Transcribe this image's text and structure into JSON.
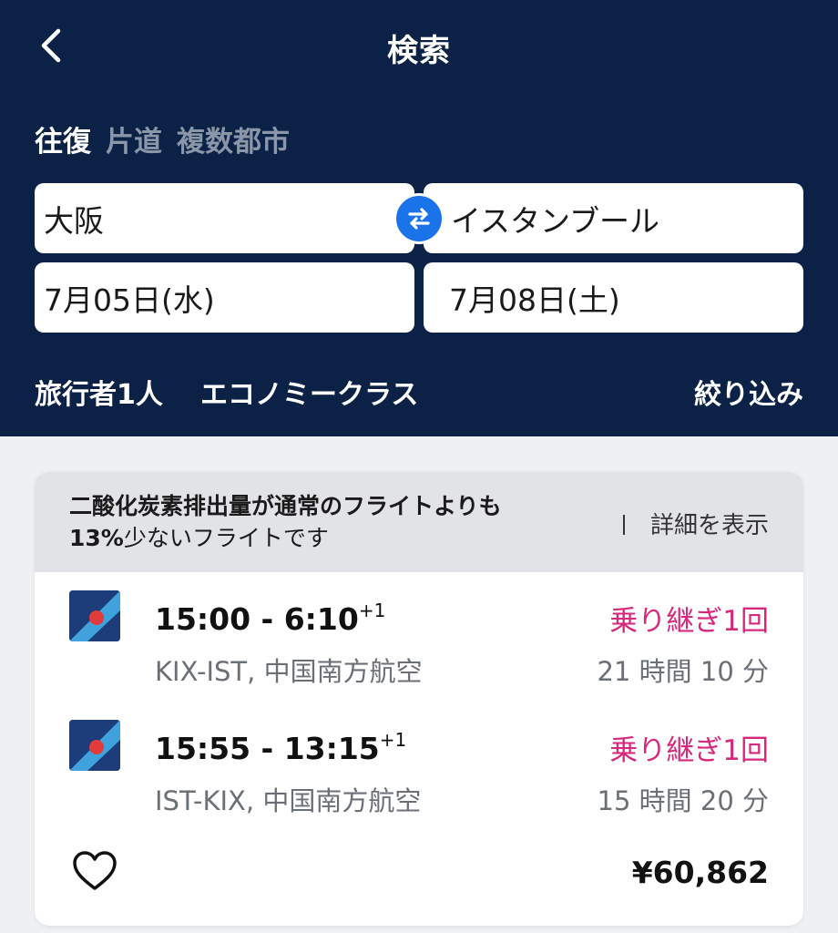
{
  "header": {
    "title": "検索",
    "trip_types": [
      {
        "label": "往復",
        "active": true
      },
      {
        "label": "片道",
        "active": false
      },
      {
        "label": "複数都市",
        "active": false
      }
    ],
    "origin": "大阪",
    "destination": "イスタンブール",
    "depart_date": "7月05日(水)",
    "return_date": "7月08日(土)",
    "travelers": "旅行者1人",
    "cabin_class": "エコノミークラス",
    "filter_label": "絞り込み",
    "icons": {
      "back": "chevron-left-icon",
      "swap": "swap-arrows-icon"
    },
    "colors": {
      "background": "#0b2246",
      "swap_button": "#1a73e8"
    }
  },
  "result": {
    "eco_banner": {
      "line1": "二酸化炭素排出量が通常のフライトよりも",
      "percent": "13%",
      "line2_rest": "少ないフライトです",
      "detail_label": "詳細を表示"
    },
    "legs": [
      {
        "time_range": "15:00 - 6:10",
        "day_offset": "+1",
        "route": "KIX-IST, 中国南方航空",
        "stops": "乗り継ぎ1回",
        "duration": "21 時間 10 分"
      },
      {
        "time_range": "15:55 - 13:15",
        "day_offset": "+1",
        "route": "IST-KIX, 中国南方航空",
        "stops": "乗り継ぎ1回",
        "duration": "15 時間 20 分"
      }
    ],
    "price": "¥60,862",
    "icons": {
      "favorite": "heart-icon",
      "airline_logo": "china-southern-logo-icon"
    },
    "colors": {
      "stops": "#d6287c"
    }
  }
}
